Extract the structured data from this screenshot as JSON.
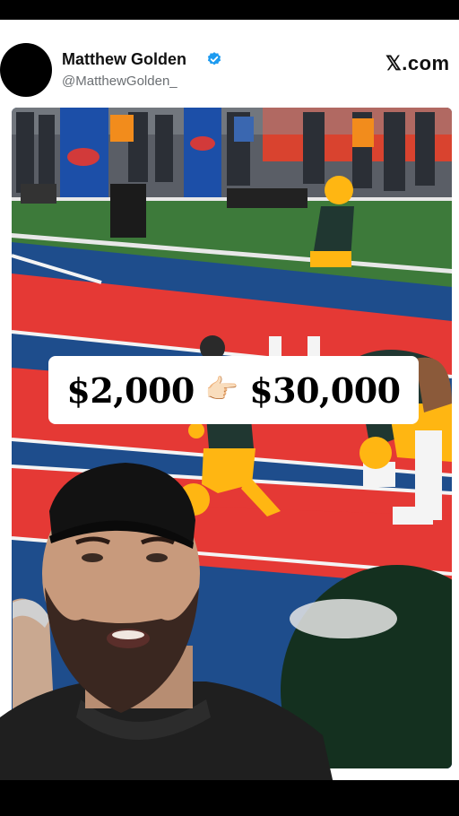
{
  "post": {
    "user_name": "Matthew Golden",
    "handle": "@MatthewGolden_",
    "platform_logo": "𝕏.com",
    "verified_icon": "verified-badge-icon"
  },
  "banner": {
    "price_from": "$2,000",
    "arrow": "👉🏻",
    "price_to": "$30,000"
  },
  "colors": {
    "verified": "#1d9bf0",
    "field_red": "#e53935",
    "field_blue": "#1e4d8c",
    "jersey_green": "#203731",
    "jersey_gold": "#ffb612"
  }
}
